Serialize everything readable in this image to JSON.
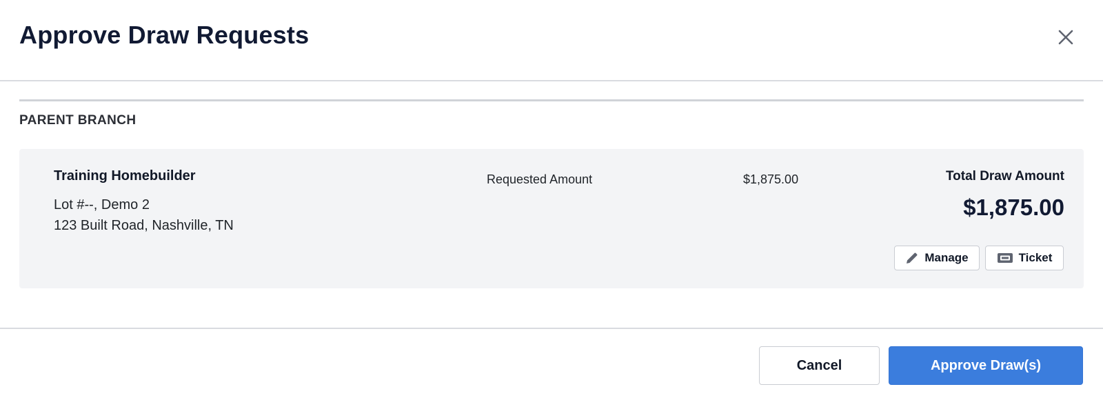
{
  "modal": {
    "title": "Approve Draw Requests"
  },
  "section": {
    "label": "PARENT BRANCH"
  },
  "draw": {
    "builder_name": "Training Homebuilder",
    "lot": "Lot #--, Demo 2",
    "address": "123 Built Road, Nashville, TN",
    "requested_label": "Requested Amount",
    "requested_value": "$1,875.00",
    "total_label": "Total Draw Amount",
    "total_value": "$1,875.00",
    "manage_label": "Manage",
    "ticket_label": "Ticket"
  },
  "footer": {
    "cancel_label": "Cancel",
    "approve_label": "Approve Draw(s)"
  },
  "icons": {
    "close": "close-icon",
    "manage": "pencil-icon",
    "ticket": "ticket-icon"
  },
  "colors": {
    "primary": "#3b7ddd",
    "card_background": "#f3f4f6",
    "title": "#111a33"
  }
}
